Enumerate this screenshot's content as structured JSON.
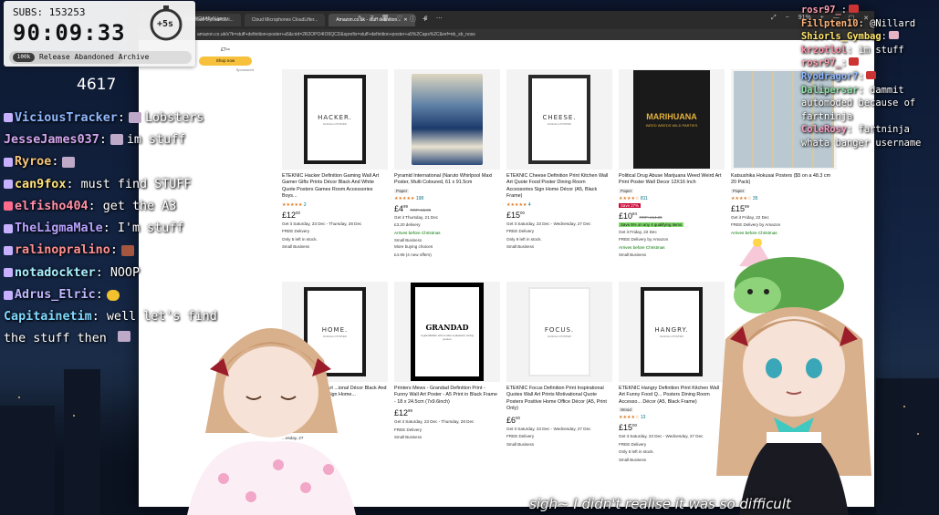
{
  "hud": {
    "subs": "SUBS: 153253",
    "timer": "90:09:33",
    "bonus": "+5s",
    "goal_number": "100k",
    "goal_text": "Release Abandoned Archive",
    "count": "4617"
  },
  "browser": {
    "image_name": "...kjr9VWQAA5yN.jpeg",
    "tabs": [
      {
        "label": "Natural Dynamic Mi..."
      },
      {
        "label": "Cloud Microphones CloudLifter..."
      },
      {
        "label": "Amazon.co.uk - stuff definition..."
      }
    ],
    "zoom": "91%",
    "url": "amazon.co.uk/s?k=stuff+definition+poster+a5&crid=2R2OPO4IO0QCD&sprefix=stuff+definition+poster+a5%2Caps%2C&ref=nb_sb_noss"
  },
  "sponsored": {
    "price": "£7⁹⁹",
    "button": "Shop now",
    "label": "Sponsored"
  },
  "row1": [
    {
      "poster": "HACKER.",
      "poster_sub": "Definition POSTER",
      "title": "ETEKNIC Hacker Definition Gaming Wall Art Gamer Gifts Prints Décor Black And White Quote Posters Games Room Accessories Boys...",
      "stars": "★★★★★",
      "reviews": "2",
      "price": "12",
      "pence": "00",
      "rrp": "",
      "l1": "Get it Saturday, 23 Dec - Thursday, 28 Dec",
      "l2": "FREE Delivery",
      "l3": "Only 5 left in stock.",
      "l4": "Small Business"
    },
    {
      "poster": "",
      "title": "Pyramid International (Naruto Whirlpool Maxi Poster, Multi Coloured, 61 x 91.5cm",
      "badge": "Paper",
      "stars": "★★★★★",
      "reviews": "198",
      "price": "4",
      "pence": "99",
      "rrp": "RRP: £5.99",
      "l1": "Get it Thursday, 21 Dec",
      "l2": "£3.20 delivery",
      "l3": "Arrives before Christmas",
      "l4": "Small Business",
      "l5": "More buying choices",
      "l6": "£4.95 (4 new offers)"
    },
    {
      "poster": "CHEESE.",
      "poster_sub": "Definition POSTER",
      "title": "ETEKNIC Cheese Definition Print Kitchen Wall Art Quote Food Poster Dining Room Accessories Sign Home Décor (A5, Black Frame)",
      "stars": "★★★★★",
      "reviews": "4",
      "price": "15",
      "pence": "00",
      "rrp": "",
      "l1": "Get it Saturday, 23 Dec - Wednesday, 27 Dec",
      "l2": "FREE Delivery",
      "l3": "Only 9 left in stock.",
      "l4": "Small Business"
    },
    {
      "poster": "MARIHUANA",
      "poster_sub": "WEED WEEDS WILD PARTIES",
      "title": "Political Drug Abuse Marijuana Weed Weird Art Print Poster Wall Decor 12X16 Inch",
      "badge": "Paper",
      "stars": "★★★★☆",
      "reviews": "811",
      "save": "Save 27%",
      "deal": "Save 5% on any 4 qualifying items",
      "price": "10",
      "pence": "94",
      "rrp": "RRP: £14.29",
      "l1": "Get it Friday, 22 Dec",
      "l2": "FREE Delivery by Amazon",
      "l3": "Arrives before Christmas",
      "l4": "Small Business"
    },
    {
      "poster": "",
      "title": "Katsushika Hokusai Posters ($5 on a 48.3 cm 20 Pack)",
      "badge": "Paper",
      "stars": "★★★★☆",
      "reviews": "35",
      "price": "15",
      "pence": "99",
      "rrp": "",
      "l1": "Get it Friday, 22 Dec",
      "l2": "FREE Delivery by Amazon",
      "l3": "Arrives before Christmas",
      "l4": ""
    }
  ],
  "row2": [
    {
      "poster": "HOME.",
      "poster_sub": "Definition POSTER",
      "title": "...me Definition Wall Art ...ional Décor Black And ...ote Posters ...oom Sign Home...",
      "price": "",
      "l1": "...esday, 27"
    },
    {
      "poster": "GRANDAD",
      "poster_sub": "A grandfather who is also a pleasant, loving person",
      "title": "Printers Mews - Grandad Definition Print - Funny Wall Art Poster - A5 Print in Black Frame - 18 x 24.5cm (7x9.6inch)",
      "price": "12",
      "pence": "99",
      "l1": "Get it Saturday, 23 Dec - Thursday, 28 Dec",
      "l2": "FREE Delivery",
      "l3": "Small Business"
    },
    {
      "poster": "FOCUS.",
      "poster_sub": "Definition POSTER",
      "title": "ETEKNIC Focus Definition Print Inspirational Quotes Wall Art Prints Motivational Quote Posters Positive Home Office Décor (A5, Print Only)",
      "price": "6",
      "pence": "00",
      "l1": "Get it Saturday, 23 Dec - Wednesday, 27 Dec",
      "l2": "FREE Delivery",
      "l3": "Small Business"
    },
    {
      "poster": "HANGRY.",
      "poster_sub": "Definition POSTER",
      "title": "ETEKNIC Hangry Definition Print Kitchen Wall Art Funny Food Q... Posters Dining Room Accesso... Décor (A5, Black Frame)",
      "badge": "Wood",
      "stars": "★★★★☆",
      "reviews": "13",
      "price": "15",
      "pence": "00",
      "l1": "Get it Saturday, 23 Dec - Wednesday, 27 Dec",
      "l2": "FREE Delivery",
      "l3": "Only 5 left in stock.",
      "l4": "Small Business"
    }
  ],
  "chat_left": [
    {
      "user": "ViciousTracker",
      "color": "#8fb8ff",
      "msg": "Lobsters"
    },
    {
      "user": "JesseJames037",
      "color": "#d3a7f0",
      "msg": "im stuff"
    },
    {
      "user": "Ryroe",
      "color": "#f3c47a",
      "msg": ""
    },
    {
      "user": "can9fox",
      "color": "#ffe07a",
      "msg": "must find STUFF"
    },
    {
      "user": "elfisho404",
      "color": "#ff8fa8",
      "msg": "get the A3"
    },
    {
      "user": "TheLigmaMale",
      "color": "#b7a2ff",
      "msg": "I'm stuff"
    },
    {
      "user": "ralinopralino",
      "color": "#ff8f8f",
      "msg": ""
    },
    {
      "user": "notadockter",
      "color": "#a9f0ff",
      "msg": "NOOP"
    },
    {
      "user": "Adrus_Elric",
      "color": "#c0b8ff",
      "msg": ""
    },
    {
      "user": "Capitainetim",
      "color": "#7fd8ff",
      "msg": "well let's find the stuff then"
    }
  ],
  "chat_right": [
    {
      "user": "rosr97_",
      "color": "#ff9fb0",
      "msg": ""
    },
    {
      "user": "Fillpten10",
      "color": "#ffb37a",
      "msg": "@Nillard"
    },
    {
      "user": "Shiorls_Gymbag",
      "color": "#ffe56a",
      "msg": ""
    },
    {
      "user": "krzotlol",
      "color": "#ff8fa8",
      "msg": "im stuff"
    },
    {
      "user": "rosr97_",
      "color": "#ff9fb0",
      "msg": ""
    },
    {
      "user": "Ryodragor7",
      "color": "#8fb8ff",
      "msg": ""
    },
    {
      "user": "Dalipersar",
      "color": "#8fe0a8",
      "msg": "dammit automoded because of fartninja"
    },
    {
      "user": "ColeRosy",
      "color": "#ff9fc8",
      "msg": "fartninja whata banger username"
    }
  ],
  "caption": "sigh~ I didn't realise it was so difficult"
}
